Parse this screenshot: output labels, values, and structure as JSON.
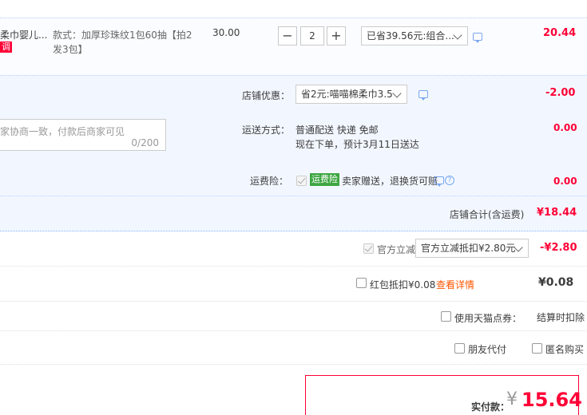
{
  "item": {
    "title": "柔巾婴儿...",
    "tag": "调",
    "spec": "款式：加厚珍珠纹1包60抽【拍2发3包】",
    "spec_line1": "款式：加厚珍珠纹1包60抽【拍2",
    "spec_line2": "发3包】",
    "price": "30.00",
    "quantity": "2",
    "minus": "−",
    "plus": "+",
    "promo_select": "已省39.56元:组合...",
    "subtotal": "20.44"
  },
  "shop": {
    "discount_label": "店铺优惠：",
    "discount_select": "省2元:喵喵棉柔巾3.5",
    "discount_amount": "-2.00",
    "message_placeholder": "家协商一致，付款后商家可见",
    "message_counter": "0/200",
    "shipping_label": "运送方式：",
    "shipping_method": "普通配送 快递 免邮",
    "shipping_eta": "现在下单，预计3月11日送达",
    "shipping_amount": "0.00",
    "insurance_label": "运费险：",
    "insurance_tag": "运费险",
    "insurance_text": "卖家赠送，退换货可赔",
    "insurance_amount": "0.00",
    "total_label": "店铺合计(含运费)",
    "total_amount": "¥18.44"
  },
  "platform": {
    "official_discount_label": "官方立减",
    "official_discount_select": "官方立减抵扣¥2.80元",
    "official_discount_amount": "-¥2.80",
    "redpacket_label": "红包抵扣¥0.08",
    "redpacket_link": "查看详情",
    "redpacket_amount": "¥0.08",
    "points_label": "使用天猫点券：",
    "points_status": "结算时扣除",
    "friend_pay": "朋友代付",
    "anonymous": "匿名购买"
  },
  "payment": {
    "label": "实付款：",
    "currency": "¥",
    "amount": "15.64"
  },
  "colors": {
    "accent_red": "#ff0036",
    "link_orange": "#ff5500",
    "promo_bg": "#f2f7ff",
    "insurance_green": "#3da642"
  }
}
